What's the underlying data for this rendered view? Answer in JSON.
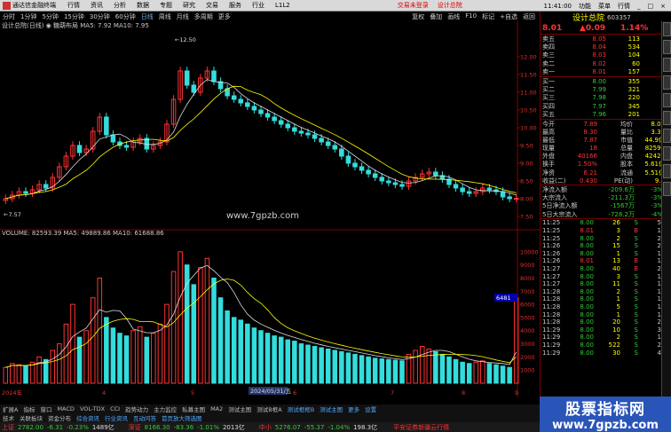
{
  "menu": {
    "app_name": "通达信金融终端",
    "items": [
      "行情",
      "资讯",
      "分析",
      "数据",
      "专题",
      "研究",
      "交易",
      "服务",
      "行业",
      "L1L2"
    ],
    "trade_labels": [
      "交易未登录",
      "设计总院"
    ],
    "window": [
      "功能",
      "菜单",
      "行情"
    ],
    "clock": "11:41:00"
  },
  "toolbar": {
    "periods": [
      "分时",
      "1分钟",
      "5分钟",
      "15分钟",
      "30分钟",
      "60分钟",
      "日线",
      "周线",
      "月线",
      "多周期",
      "更多"
    ],
    "selected": "日线",
    "right": [
      "复权",
      "叠加",
      "画线",
      "F10",
      "标记",
      "+自选",
      "返回"
    ]
  },
  "price_legend": "设计总院(日线)  ◉ 糖葫布局  MA5: 7.92  MA10: 7.95",
  "vol_legend": "VOLUME: 82593.39  MA5: 49889.86  MA10: 61688.86",
  "price_axis": [
    "12.00",
    "11.50",
    "11.00",
    "10.50",
    "10.00",
    "9.50",
    "9.00",
    "8.50",
    "8.00",
    "7.50"
  ],
  "vol_axis": [
    "10000",
    "9000",
    "8000",
    "7000",
    "6000",
    "5000",
    "4000",
    "3000",
    "2000",
    "1000"
  ],
  "annotations": {
    "high": "12.50",
    "low": "7.57",
    "watermark": "www.7gpzb.com",
    "vol_marker": "6481",
    "date_label": "2024/05/31/五"
  },
  "x_axis": [
    "2024年",
    "4",
    "5",
    "6",
    "7",
    "8",
    "9"
  ],
  "tabs": [
    "扩展A",
    "指标",
    "窗口",
    "MACD",
    "VOL-TDX",
    "CCI",
    "趋势动力",
    "主力监控",
    "私募主图",
    "MA2",
    "测试主图",
    "测试B框A",
    "测试框框B",
    "测试主图",
    "更多",
    "设置"
  ],
  "tabs2": [
    "技术",
    "关联板块",
    "资金分布",
    "综合资讯",
    "行业资讯",
    "互动问答",
    "首页放大筛选图"
  ],
  "stock": {
    "name": "设计总院",
    "code": "603357",
    "price": "8.01",
    "change": "▲0.09",
    "pct": "1.14%"
  },
  "asks": [
    [
      "卖五",
      "8.05",
      "113"
    ],
    [
      "卖四",
      "8.04",
      "534"
    ],
    [
      "卖三",
      "8.03",
      "104"
    ],
    [
      "卖二",
      "8.02",
      "60"
    ],
    [
      "卖一",
      "8.01",
      "157"
    ]
  ],
  "bids": [
    [
      "买一",
      "8.00",
      "355"
    ],
    [
      "买二",
      "7.99",
      "321"
    ],
    [
      "买三",
      "7.98",
      "220"
    ],
    [
      "买四",
      "7.97",
      "345"
    ],
    [
      "买五",
      "7.96",
      "201"
    ]
  ],
  "stats": [
    [
      "今开",
      "7.89",
      "均价",
      "8.09"
    ],
    [
      "最高",
      "8.30",
      "量比",
      "3.31"
    ],
    [
      "最低",
      "7.87",
      "市值",
      "44.9亿"
    ],
    [
      "现量",
      "18",
      "总量",
      "82593"
    ],
    [
      "外盘",
      "40166",
      "内盘",
      "42427"
    ],
    [
      "换手",
      "1.50%",
      "股本",
      "5.61亿"
    ],
    [
      "净资",
      "6.21",
      "流通",
      "5.51亿"
    ],
    [
      "收益(二)",
      "0.430",
      "PE(动)",
      "9.6"
    ]
  ],
  "flows": [
    [
      "净流入额",
      "-209.6万",
      "-3%"
    ],
    [
      "大宗流入",
      "-211.3万",
      "-3%"
    ],
    [
      "5日净流入额",
      "-1567万",
      "-3%"
    ],
    [
      "5日大宗流入",
      "-728.2万",
      "-4%"
    ]
  ],
  "ticks": [
    [
      "11:25",
      "8.00",
      "26",
      "S",
      "5"
    ],
    [
      "11:25",
      "8.01",
      "3",
      "B",
      "1"
    ],
    [
      "11:25",
      "8.00",
      "2",
      "S",
      "2"
    ],
    [
      "11:26",
      "8.00",
      "15",
      "S",
      "2"
    ],
    [
      "11:26",
      "8.00",
      "1",
      "S",
      "1"
    ],
    [
      "11:26",
      "8.01",
      "13",
      "B",
      "1"
    ],
    [
      "11:27",
      "8.00",
      "40",
      "B",
      "2"
    ],
    [
      "11:27",
      "8.00",
      "3",
      "S",
      "1"
    ],
    [
      "11:27",
      "8.00",
      "11",
      "S",
      "1"
    ],
    [
      "11:28",
      "8.00",
      "2",
      "S",
      "1"
    ],
    [
      "11:28",
      "8.00",
      "1",
      "S",
      "1"
    ],
    [
      "11:28",
      "8.00",
      "5",
      "S",
      "1"
    ],
    [
      "11:28",
      "8.00",
      "1",
      "S",
      "1"
    ],
    [
      "11:28",
      "8.00",
      "20",
      "S",
      "2"
    ],
    [
      "11:29",
      "8.00",
      "10",
      "S",
      "3"
    ],
    [
      "11:29",
      "8.00",
      "2",
      "S",
      "1"
    ],
    [
      "11:29",
      "8.00",
      "522",
      "S",
      "2"
    ],
    [
      "11:29",
      "8.00",
      "30",
      "S",
      "4"
    ]
  ],
  "status": {
    "sh": [
      "上证",
      "2782.00",
      "-6.31",
      "-0.23%",
      "1489亿"
    ],
    "sz": [
      "深证",
      "8166.30",
      "-83.36",
      "-1.01%",
      "2013亿"
    ],
    "zx": [
      "中小",
      "5276.07",
      "-55.37",
      "-1.04%",
      "198.3亿"
    ],
    "msg": "平安证券新疆云行情"
  },
  "promo": {
    "big": "股票指标网",
    "sm": "www.7gpzb.com"
  },
  "colors": {
    "up": "#ff3333",
    "down": "#33dddd",
    "ma5": "#dddddd",
    "ma10": "#ffff00"
  },
  "chart_data": {
    "type": "candlestick",
    "ylim": [
      7.3,
      12.8
    ],
    "closes": [
      8.0,
      8.1,
      8.2,
      8.15,
      8.25,
      8.4,
      8.3,
      8.6,
      8.9,
      9.2,
      9.5,
      9.3,
      9.4,
      9.9,
      10.3,
      9.8,
      9.6,
      9.5,
      9.45,
      9.6,
      9.7,
      9.4,
      9.5,
      9.6,
      10.1,
      10.8,
      11.6,
      11.2,
      11.0,
      11.4,
      11.6,
      11.3,
      11.1,
      10.9,
      10.8,
      10.7,
      10.6,
      10.5,
      10.4,
      10.3,
      10.2,
      10.1,
      10.0,
      9.9,
      9.85,
      9.8,
      9.7,
      9.6,
      9.5,
      9.4,
      9.2,
      9.0,
      8.9,
      8.8,
      8.7,
      8.6,
      8.5,
      8.45,
      8.4,
      8.35,
      8.5,
      8.6,
      8.7,
      8.75,
      8.65,
      8.55,
      8.4,
      8.3,
      8.2,
      8.15,
      8.2,
      8.3,
      8.25,
      8.2,
      8.05,
      8.0,
      8.01
    ],
    "volumes": [
      1200,
      1500,
      1400,
      1300,
      1600,
      2000,
      1800,
      2500,
      3000,
      4500,
      6000,
      3500,
      4000,
      6500,
      8000,
      5000,
      4200,
      3800,
      3600,
      4000,
      4300,
      3500,
      3800,
      4500,
      6000,
      8500,
      10000,
      9000,
      7500,
      8800,
      9500,
      8000,
      6500,
      5500,
      5000,
      4800,
      4500,
      4200,
      4000,
      3800,
      3600,
      3500,
      3300,
      3200,
      3000,
      2900,
      2800,
      2700,
      2600,
      2500,
      2400,
      2300,
      2200,
      2100,
      2000,
      1900,
      1850,
      1800,
      1750,
      1700,
      2200,
      2500,
      2800,
      2600,
      2400,
      2200,
      2000,
      1800,
      1600,
      1500,
      1600,
      1700,
      1500,
      1400,
      1300,
      1200,
      6481
    ]
  }
}
